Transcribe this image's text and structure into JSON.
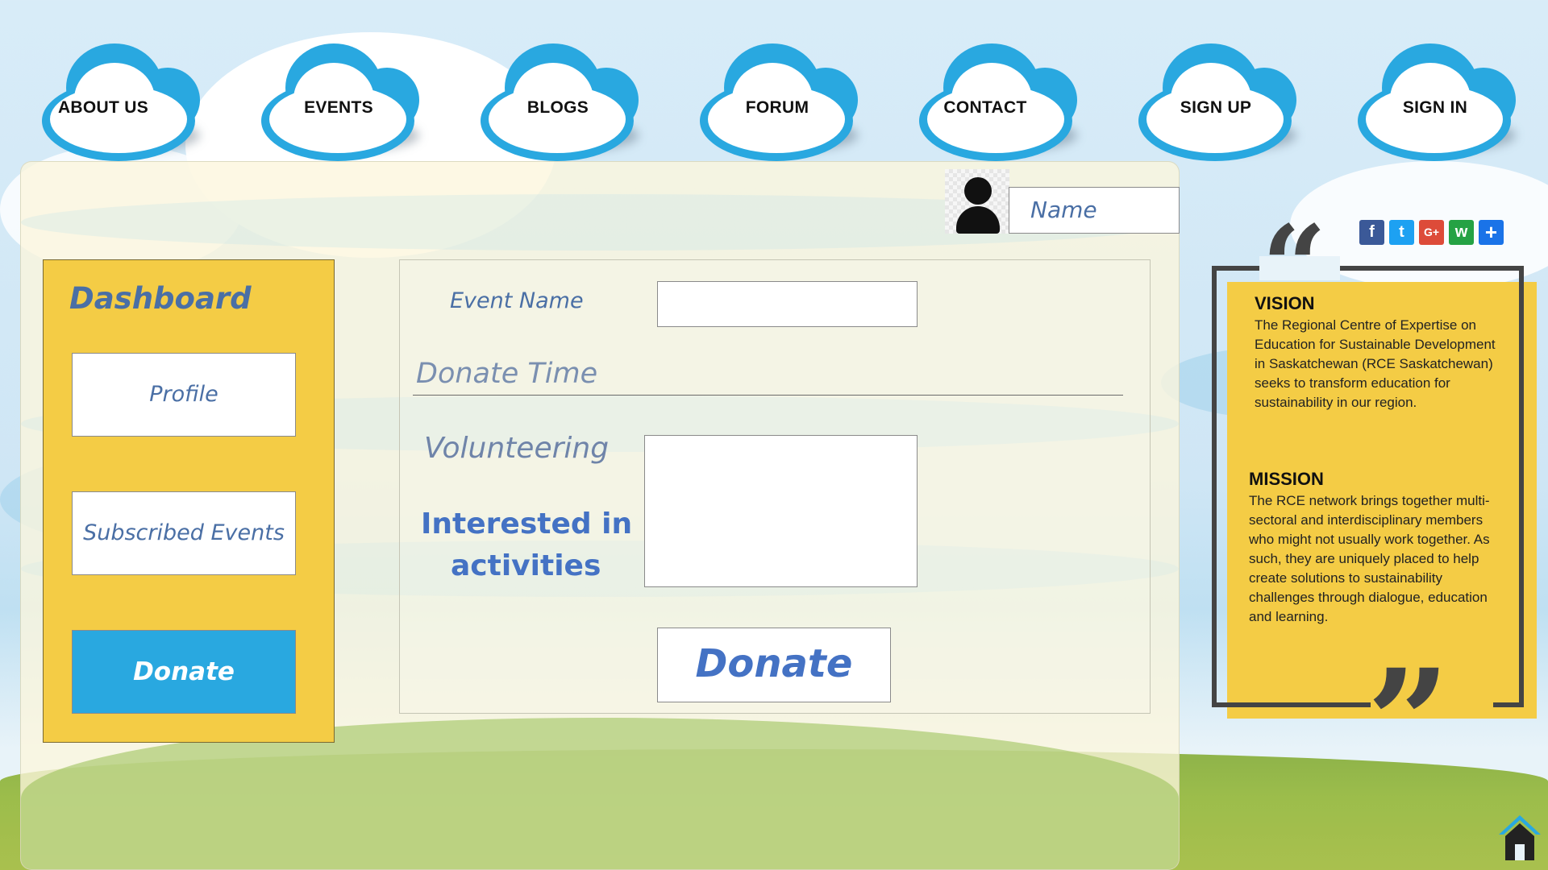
{
  "nav": {
    "items": [
      {
        "label": "ABOUT US"
      },
      {
        "label": "EVENTS"
      },
      {
        "label": "BLOGS"
      },
      {
        "label": "FORUM"
      },
      {
        "label": "CONTACT"
      },
      {
        "label": "SIGN UP"
      },
      {
        "label": "SIGN IN"
      }
    ]
  },
  "user": {
    "name_placeholder": "Name"
  },
  "sidebar": {
    "title": "Dashboard",
    "items": [
      {
        "label": "Profile"
      },
      {
        "label": "Subscribed Events"
      },
      {
        "label": "Donate"
      }
    ]
  },
  "form": {
    "event_name_label": "Event Name",
    "donate_time_label": "Donate Time",
    "volunteering_label": "Volunteering",
    "interested_label_line1": "Interested in",
    "interested_label_line2": "activities",
    "submit_label": "Donate"
  },
  "share": {
    "icons": [
      "facebook-icon",
      "twitter-icon",
      "google-plus-icon",
      "whatsapp-icon",
      "share-plus-icon"
    ],
    "glyphs": [
      "f",
      "t",
      "G+",
      "w",
      "+"
    ]
  },
  "info": {
    "vision_heading": "VISION",
    "vision_text": "The Regional Centre of Expertise on Education for Sustainable Development in Saskatchewan (RCE Saskatchewan) seeks to transform education for sustainability in our region.",
    "mission_heading": "MISSION",
    "mission_text": "The RCE network brings together multi-sectoral and interdisciplinary members who might not usually work together. As such, they are uniquely placed to help create solutions to sustainability challenges through dialogue, education and learning.",
    "open_quote": "“",
    "close_quote": "”"
  },
  "colors": {
    "accent_blue": "#29a8e0",
    "panel_yellow": "#f4cc45",
    "text_blue": "#4a6fa5",
    "facebook": "#3b5998",
    "twitter": "#1da1f2",
    "google_plus": "#dd4b39",
    "whatsapp": "#25a244",
    "share": "#1a73e8"
  }
}
